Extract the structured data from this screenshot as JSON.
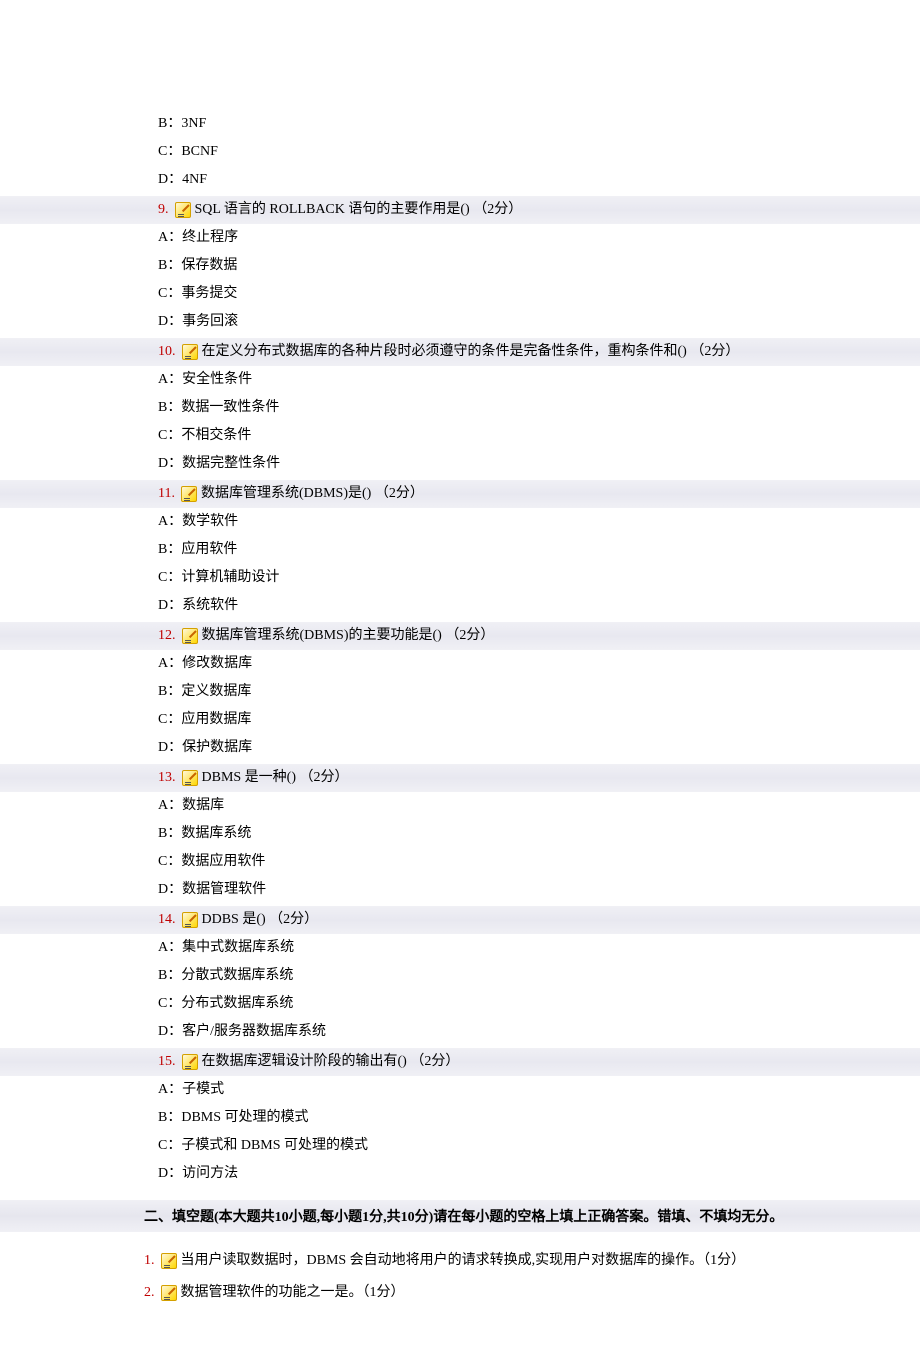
{
  "orphan_options": [
    "B：3NF",
    "C：BCNF",
    "D：4NF"
  ],
  "questions": [
    {
      "num": "9.",
      "text": "SQL 语言的 ROLLBACK 语句的主要作用是() （2分）",
      "options": [
        "A：终止程序",
        "B：保存数据",
        "C：事务提交",
        "D：事务回滚"
      ]
    },
    {
      "num": "10.",
      "text": "在定义分布式数据库的各种片段时必须遵守的条件是完备性条件，重构条件和() （2分）",
      "options": [
        "A：安全性条件",
        "B：数据一致性条件",
        "C：不相交条件",
        "D：数据完整性条件"
      ]
    },
    {
      "num": "11.",
      "text": "数据库管理系统(DBMS)是() （2分）",
      "options": [
        "A：数学软件",
        "B：应用软件",
        "C：计算机辅助设计",
        "D：系统软件"
      ]
    },
    {
      "num": "12.",
      "text": "数据库管理系统(DBMS)的主要功能是() （2分）",
      "options": [
        "A：修改数据库",
        "B：定义数据库",
        "C：应用数据库",
        "D：保护数据库"
      ]
    },
    {
      "num": "13.",
      "text": "DBMS 是一种() （2分）",
      "options": [
        "A：数据库",
        "B：数据库系统",
        "C：数据应用软件",
        "D：数据管理软件"
      ]
    },
    {
      "num": "14.",
      "text": "DDBS 是() （2分）",
      "options": [
        "A：集中式数据库系统",
        "B：分散式数据库系统",
        "C：分布式数据库系统",
        "D：客户/服务器数据库系统"
      ]
    },
    {
      "num": "15.",
      "text": "在数据库逻辑设计阶段的输出有() （2分）",
      "options": [
        "A：子模式",
        "B：DBMS 可处理的模式",
        "C：子模式和 DBMS 可处理的模式",
        "D：访问方法"
      ]
    }
  ],
  "section2_header": "二、填空题(本大题共10小题,每小题1分,共10分)请在每小题的空格上填上正确答案。错填、不填均无分。",
  "fill_questions": [
    {
      "num": "1.",
      "text": "当用户读取数据时，DBMS 会自动地将用户的请求转换成,实现用户对数据库的操作。（1分）"
    },
    {
      "num": "2.",
      "text": "数据管理软件的功能之一是。（1分）"
    }
  ]
}
